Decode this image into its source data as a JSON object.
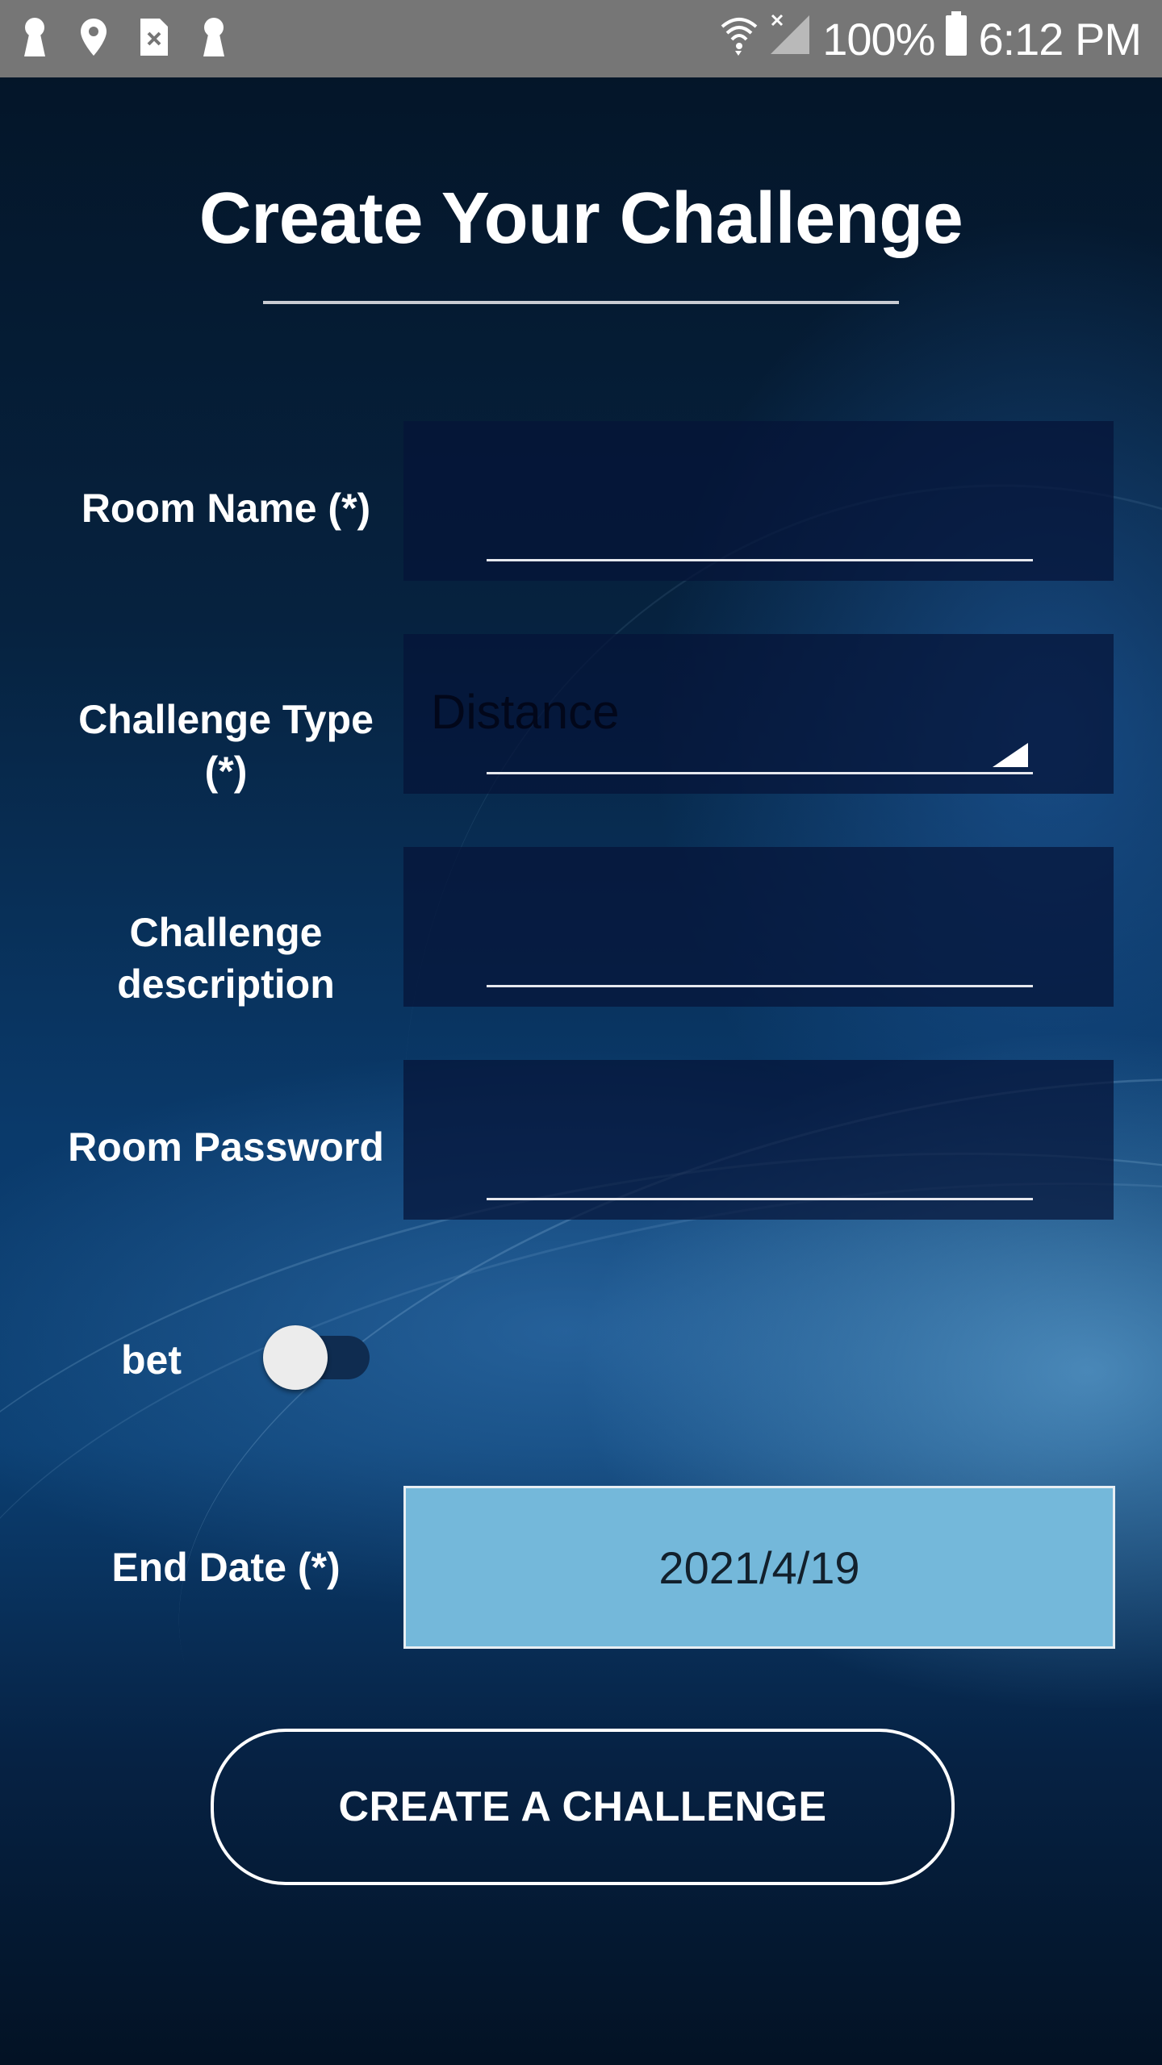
{
  "status_bar": {
    "battery": "100%",
    "time": "6:12 PM",
    "icons_left": [
      "keyhole-icon",
      "location-pin-icon",
      "sim-card-icon",
      "keyhole-icon"
    ],
    "icons_right": [
      "wifi-icon",
      "signal-icon",
      "battery-icon"
    ]
  },
  "page": {
    "title": "Create Your Challenge"
  },
  "form": {
    "room_name_label": "Room Name (*)",
    "room_name_value": "",
    "challenge_type_label_line1": "Challenge Type",
    "challenge_type_label_line2": "(*)",
    "challenge_type_value": "Distance",
    "description_label_line1": "Challenge",
    "description_label_line2": "description",
    "description_value": "",
    "password_label": "Room Password",
    "password_value": "",
    "bet_label": "bet",
    "bet_enabled": false,
    "end_date_label": "End Date (*)",
    "end_date_value": "2021/4/19"
  },
  "actions": {
    "create_label": "CREATE A CHALLENGE"
  },
  "colors": {
    "status_bar": "#767676",
    "date_box": "#74b8da",
    "field_bg": "#05143a",
    "text": "#ffffff"
  }
}
